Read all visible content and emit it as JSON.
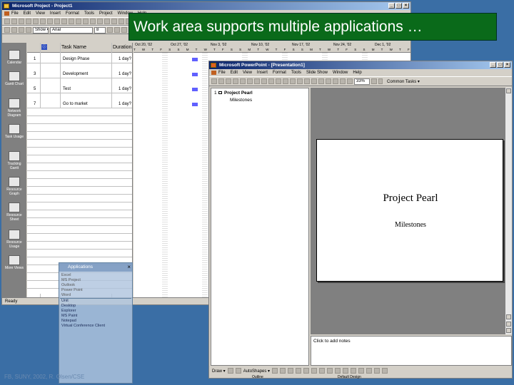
{
  "caption": "Work area supports multiple applications …",
  "footer_text": "FB, SUNY, 2002, R. Olsen/CSE",
  "project_window": {
    "title": "Microsoft Project - Project1",
    "menu": [
      "File",
      "Edit",
      "View",
      "Insert",
      "Format",
      "Tools",
      "Project",
      "Window",
      "Help"
    ],
    "toolbar_combos": {
      "show": "Show ▾",
      "font": "Arial",
      "size": "8"
    },
    "view_bar": [
      "Calendar",
      "Gantt Chart",
      "Network Diagram",
      "Task Usage",
      "Tracking Gantt",
      "Resource Graph",
      "Resource Sheet",
      "Resource Usage",
      "More Views"
    ],
    "columns": {
      "id": "ⓘ",
      "name": "Task Name",
      "duration": "Duration"
    },
    "tasks": [
      {
        "id": "1",
        "name": "Design Phase",
        "duration": "1 day?"
      },
      {
        "id": "3",
        "name": "Development",
        "duration": "1 day?"
      },
      {
        "id": "5",
        "name": "Test",
        "duration": "1 day?"
      },
      {
        "id": "7",
        "name": "Go to market",
        "duration": "1 day?"
      }
    ],
    "timescale_weeks": [
      "Oct 20, '02",
      "Oct 27, '02",
      "Nov 3, '02",
      "Nov 10, '02",
      "Nov 17, '02",
      "Nov 24, '02",
      "Dec 1, '02"
    ],
    "status": "Ready"
  },
  "applications_panel": {
    "title": "Applications",
    "items": [
      "Excel",
      "MS Project",
      "Outlook",
      "Power Point",
      "Word",
      "Unit",
      "Desktop",
      "Explorer",
      "MS Paint",
      "Notepad",
      "Virtual Conference Client"
    ]
  },
  "ppt_window": {
    "title": "Microsoft PowerPoint - [Presentation1]",
    "menu": [
      "File",
      "Edit",
      "View",
      "Insert",
      "Format",
      "Tools",
      "Slide Show",
      "Window",
      "Help"
    ],
    "zoom": "33%",
    "tasks_label": "Common Tasks ▾",
    "outline": {
      "num": "1",
      "title": "Project Pearl",
      "sub": "Milestones"
    },
    "slide": {
      "title": "Project Pearl",
      "subtitle": "Milestones"
    },
    "notes_placeholder": "Click to add notes",
    "draw_label": "Draw ▾",
    "autoshapes_label": "AutoShapes ▾",
    "status_outline": "Outline",
    "status_design": "Default Design"
  },
  "colors": {
    "title_bar": "#0a246a",
    "caption_bg": "#0a6a1a",
    "desktop": "#3a6ea5",
    "gantt_bar": "#6060ff"
  }
}
